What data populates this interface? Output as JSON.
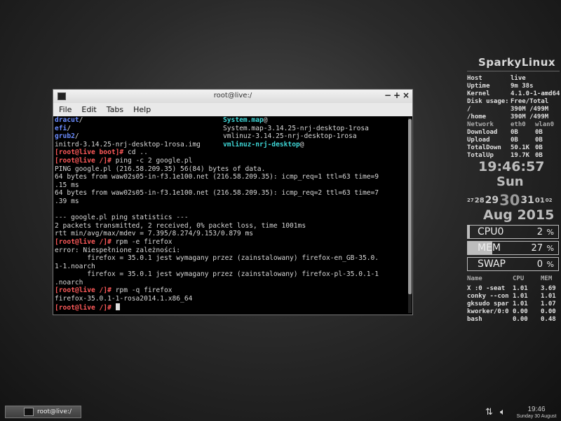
{
  "terminal": {
    "title": "root@live:/",
    "menu": [
      "File",
      "Edit",
      "Tabs",
      "Help"
    ],
    "lines": [
      [
        {
          "t": "dracut",
          "c": "c-dir"
        },
        {
          "t": "/",
          "c": "c-pl"
        },
        {
          "col2": true,
          "t": "System.map",
          "c": "c-cyan"
        },
        {
          "t": "@",
          "c": "c-pl"
        }
      ],
      [
        {
          "t": "efi",
          "c": "c-dir"
        },
        {
          "t": "/",
          "c": "c-pl"
        },
        {
          "col2": true,
          "t": "System.map-3.14.25-nrj-desktop-1rosa",
          "c": "c-pl"
        }
      ],
      [
        {
          "t": "grub2",
          "c": "c-dir"
        },
        {
          "t": "/",
          "c": "c-pl"
        },
        {
          "col2": true,
          "t": "vmlinuz-3.14.25-nrj-desktop-1rosa",
          "c": "c-pl"
        }
      ],
      [
        {
          "t": "initrd-3.14.25-nrj-desktop-1rosa.img",
          "c": "c-pl"
        },
        {
          "col2": true,
          "t": "vmlinuz-nrj-desktop",
          "c": "c-cyan"
        },
        {
          "t": "@",
          "c": "c-pl"
        }
      ],
      [
        {
          "t": "[root@live boot]# ",
          "c": "c-red"
        },
        {
          "t": "cd ..",
          "c": "c-pl"
        }
      ],
      [
        {
          "t": "[root@live /]# ",
          "c": "c-red"
        },
        {
          "t": "ping -c 2 google.pl",
          "c": "c-pl"
        }
      ],
      [
        {
          "t": "PING google.pl (216.58.209.35) 56(84) bytes of data.",
          "c": "c-pl"
        }
      ],
      [
        {
          "t": "64 bytes from waw02s05-in-f3.1e100.net (216.58.209.35): icmp_req=1 ttl=63 time=9",
          "c": "c-pl"
        }
      ],
      [
        {
          "t": ".15 ms",
          "c": "c-pl"
        }
      ],
      [
        {
          "t": "64 bytes from waw02s05-in-f3.1e100.net (216.58.209.35): icmp_req=2 ttl=63 time=7",
          "c": "c-pl"
        }
      ],
      [
        {
          "t": ".39 ms",
          "c": "c-pl"
        }
      ],
      [
        {
          "t": "",
          "c": "c-pl"
        }
      ],
      [
        {
          "t": "--- google.pl ping statistics ---",
          "c": "c-pl"
        }
      ],
      [
        {
          "t": "2 packets transmitted, 2 received, 0% packet loss, time 1001ms",
          "c": "c-pl"
        }
      ],
      [
        {
          "t": "rtt min/avg/max/mdev = 7.395/8.274/9.153/0.879 ms",
          "c": "c-pl"
        }
      ],
      [
        {
          "t": "[root@live /]# ",
          "c": "c-red"
        },
        {
          "t": "rpm -e firefox",
          "c": "c-pl"
        }
      ],
      [
        {
          "t": "error: Niespełnione zależności:",
          "c": "c-pl"
        }
      ],
      [
        {
          "t": "        firefox = 35.0.1 jest wymagany przez (zainstalowany) firefox-en_GB-35.0.",
          "c": "c-pl"
        }
      ],
      [
        {
          "t": "1-1.noarch",
          "c": "c-pl"
        }
      ],
      [
        {
          "t": "        firefox = 35.0.1 jest wymagany przez (zainstalowany) firefox-pl-35.0.1-1",
          "c": "c-pl"
        }
      ],
      [
        {
          "t": ".noarch",
          "c": "c-pl"
        }
      ],
      [
        {
          "t": "[root@live /]# ",
          "c": "c-red"
        },
        {
          "t": "rpm -q firefox",
          "c": "c-pl"
        }
      ],
      [
        {
          "t": "firefox-35.0.1-1-rosa2014.1.x86_64",
          "c": "c-pl"
        }
      ],
      [
        {
          "t": "[root@live /]# ",
          "c": "c-red"
        },
        {
          "cursor": true
        }
      ]
    ]
  },
  "conky": {
    "distro": "SparkyLinux",
    "system": [
      {
        "k": "Host",
        "v": "live"
      },
      {
        "k": "Uptime",
        "v": "9m 38s"
      },
      {
        "k": "Kernel",
        "v": "4.1.0-1-amd64"
      },
      {
        "k": "Disk usage:",
        "v": "Free/Total"
      },
      {
        "k": "/",
        "v": "390M /499M"
      },
      {
        "k": "/home",
        "v": "390M /499M"
      }
    ],
    "network_header": {
      "k": "Network",
      "v": "eth0",
      "v2": "wlan0"
    },
    "network": [
      {
        "k": "Download",
        "v": "0B",
        "v2": "0B"
      },
      {
        "k": "Upload",
        "v": "0B",
        "v2": "0B"
      },
      {
        "k": "TotalDown",
        "v": "50.1K",
        "v2": "0B"
      },
      {
        "k": "TotalUp",
        "v": "19.7K",
        "v2": "0B"
      }
    ],
    "time": "19:46:57",
    "day": "Sun",
    "dates": [
      "27",
      "28",
      "29",
      "30",
      "31",
      "01",
      "02"
    ],
    "month_year": "Aug 2015",
    "meters": [
      {
        "label": "CPU0",
        "value": "2",
        "unit": "%",
        "level": 0.02
      },
      {
        "label": "MEM",
        "value": "27",
        "unit": "%",
        "level": 0.27
      },
      {
        "label": "SWAP",
        "value": "0",
        "unit": "%",
        "level": 0.0
      }
    ],
    "proc_header": {
      "name": "Name",
      "cpu": "CPU",
      "mem": "MEM"
    },
    "processes": [
      {
        "name": "X :0 -seat",
        "cpu": "1.01",
        "mem": "3.69"
      },
      {
        "name": "conky --con",
        "cpu": "1.01",
        "mem": "1.01"
      },
      {
        "name": "gksudo spar",
        "cpu": "1.01",
        "mem": "1.07"
      },
      {
        "name": "kworker/0:0",
        "cpu": "0.00",
        "mem": "0.00"
      },
      {
        "name": "bash",
        "cpu": "0.00",
        "mem": "0.48"
      }
    ]
  },
  "taskbar": {
    "task_label": "root@live:/",
    "clock_time": "19:46",
    "clock_date": "Sunday 30 August"
  }
}
